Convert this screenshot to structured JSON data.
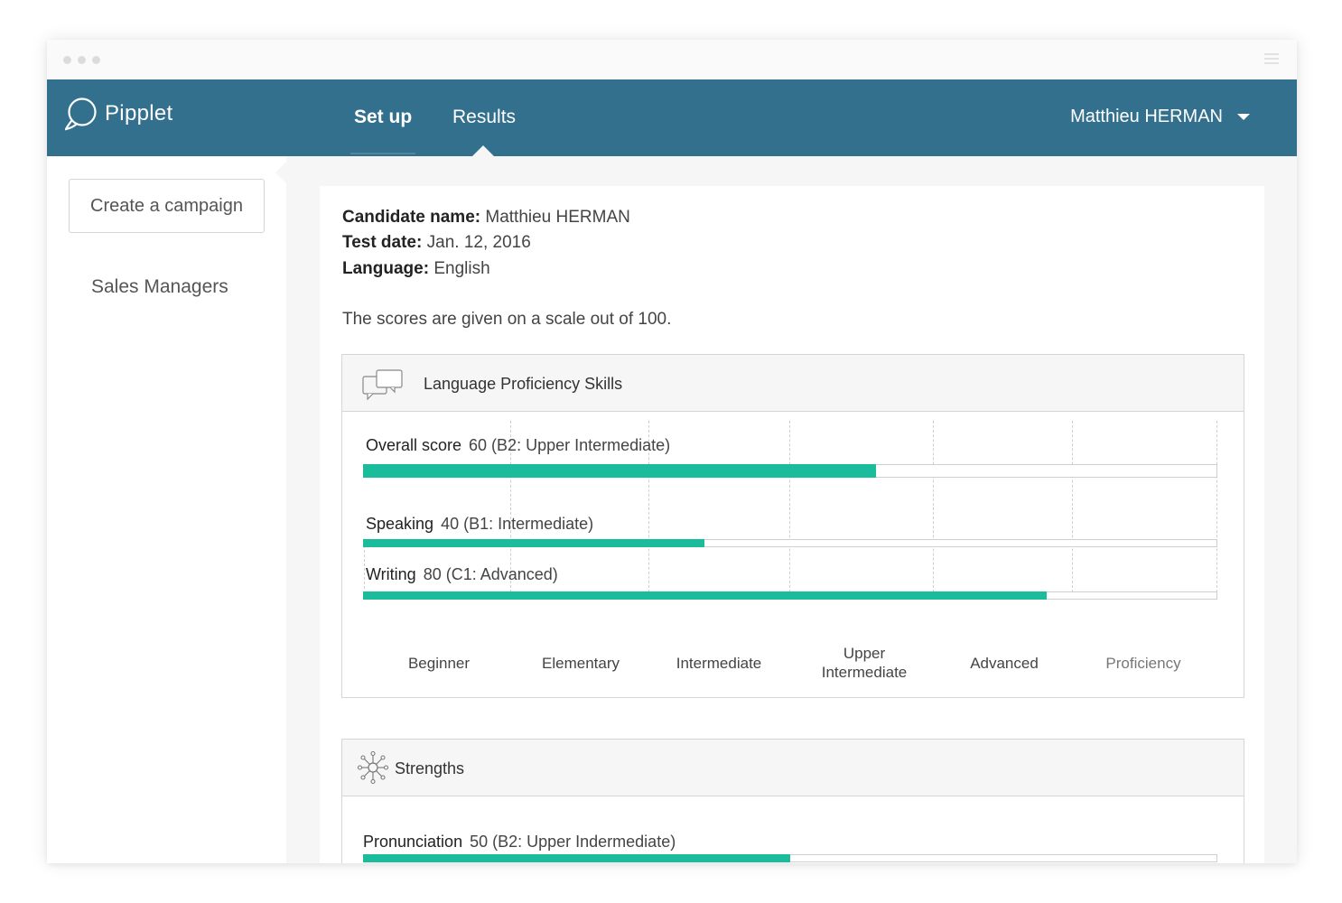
{
  "app": {
    "name": "Pipplet",
    "nav": {
      "setup_label": "Set up",
      "results_label": "Results"
    },
    "user": {
      "name": "Matthieu HERMAN"
    }
  },
  "sidebar": {
    "create_button": "Create a campaign",
    "campaigns": [
      "Sales Managers"
    ]
  },
  "candidate": {
    "name_label": "Candidate name:",
    "name": "Matthieu HERMAN",
    "date_label": "Test date:",
    "date": "Jan. 12, 2016",
    "language_label": "Language:",
    "language": "English",
    "scale_note": "The scores are given on a scale out of 100."
  },
  "proficiency": {
    "title": "Language Proficiency Skills",
    "skills": [
      {
        "name": "Overall score",
        "value_text": "60 (B2: Upper Intermediate)",
        "score": 60
      },
      {
        "name": "Speaking",
        "value_text": "40 (B1: Intermediate)",
        "score": 40
      },
      {
        "name": "Writing",
        "value_text": "80 (C1: Advanced)",
        "score": 80
      }
    ],
    "levels": [
      "Beginner",
      "Elementary",
      "Intermediate",
      "Upper\nIntermediate",
      "Advanced",
      "Proficiency"
    ]
  },
  "strengths": {
    "title": "Strengths",
    "skills": [
      {
        "name": "Pronunciation",
        "value_text": "50 (B2: Upper Indermediate)",
        "score": 50
      }
    ]
  },
  "colors": {
    "navbar": "#33708e",
    "accent": "#1bbc9b",
    "background": "#f6f6f6"
  },
  "icons": {
    "logo": "pipplet-logo-icon",
    "proficiency": "speech-bubbles-icon",
    "strengths": "network-icon",
    "user_menu": "caret-down-icon"
  }
}
